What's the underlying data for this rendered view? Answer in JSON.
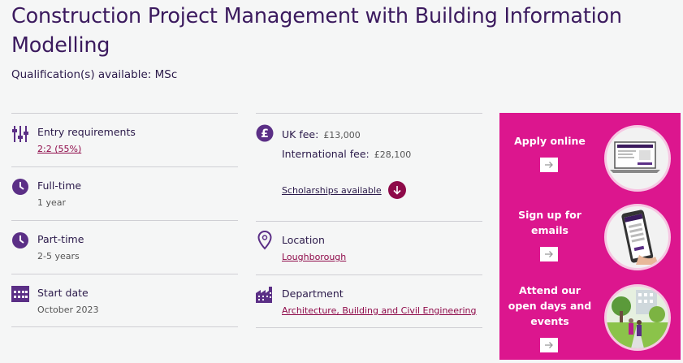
{
  "page": {
    "title": "Construction Project Management with Building Information Modelling",
    "qualifications": "Qualification(s) available: MSc"
  },
  "left_column": {
    "entry": {
      "label": "Entry requirements",
      "value": "2:2 (55%)",
      "icon": "sliders-icon"
    },
    "fulltime": {
      "label": "Full-time",
      "value": "1 year",
      "icon": "clock-icon"
    },
    "parttime": {
      "label": "Part-time",
      "value": "2-5 years",
      "icon": "clock-icon"
    },
    "start": {
      "label": "Start date",
      "value": "October 2023",
      "icon": "calendar-icon"
    }
  },
  "middle_column": {
    "fees": {
      "uk_label": "UK fee:",
      "uk_value": "£13,000",
      "intl_label": "International fee:",
      "intl_value": "£28,100",
      "scholarships": "Scholarships available",
      "icon": "pound-icon"
    },
    "location": {
      "label": "Location",
      "value": "Loughborough",
      "icon": "map-pin-icon"
    },
    "department": {
      "label": "Department",
      "value": "Architecture, Building and Civil Engineering",
      "icon": "building-icon"
    }
  },
  "cta_panel": {
    "apply": "Apply online",
    "signup_line1": "Sign up for",
    "signup_line2": "emails",
    "opendays_line1": "Attend our",
    "opendays_line2": "open days and",
    "opendays_line3": "events"
  },
  "colors": {
    "accent": "#8e0a49",
    "panel": "#dc168e",
    "icon": "#5b2f86"
  }
}
